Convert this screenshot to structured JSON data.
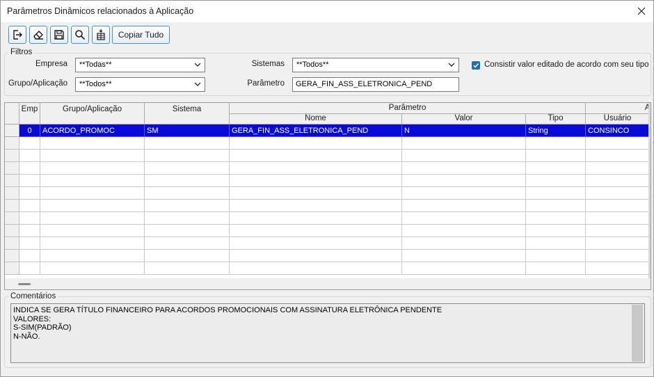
{
  "window": {
    "title": "Parâmetros Dinâmicos relacionados à Aplicação"
  },
  "toolbar": {
    "icons": [
      "exit-icon",
      "eraser-icon",
      "save-icon",
      "search-icon",
      "grid-insert-icon"
    ],
    "copy_all_label": "Copiar Tudo"
  },
  "filters": {
    "group_label": "Filtros",
    "empresa_label": "Empresa",
    "empresa_value": "**Todas**",
    "sistemas_label": "Sistemas",
    "sistemas_value": "**Todos**",
    "grupo_label": "Grupo/Aplicação",
    "grupo_value": "**Todos**",
    "parametro_label": "Parâmetro",
    "parametro_value": "GERA_FIN_ASS_ELETRONICA_PEND",
    "consistir_label": "Consistir valor editado de acordo com seu tipo",
    "consistir_checked": true
  },
  "grid": {
    "headers": {
      "emp": "Emp",
      "grupo": "Grupo/Aplicação",
      "sistema": "Sistema",
      "parametro": "Parâmetro",
      "nome": "Nome",
      "valor": "Valor",
      "tipo": "Tipo",
      "alt": "Al",
      "usuario": "Usuário"
    },
    "rows": [
      {
        "emp": "0",
        "grupo": "ACORDO_PROMOC",
        "sistema": "SM",
        "nome": "GERA_FIN_ASS_ELETRONICA_PEND",
        "valor": "N",
        "tipo": "String",
        "usuario": "CONSINCO"
      }
    ],
    "empty_rows": 11
  },
  "comments": {
    "group_label": "Comentários",
    "lines": [
      "INDICA SE GERA TÍTULO FINANCEIRO PARA ACORDOS PROMOCIONAIS COM ASSINATURA ELETRÔNICA PENDENTE",
      "VALORES:",
      "S-SIM(PADRÃO)",
      "N-NÃO."
    ]
  },
  "colors": {
    "selection": "#0a0ad8",
    "accent": "#1f6fb0"
  }
}
